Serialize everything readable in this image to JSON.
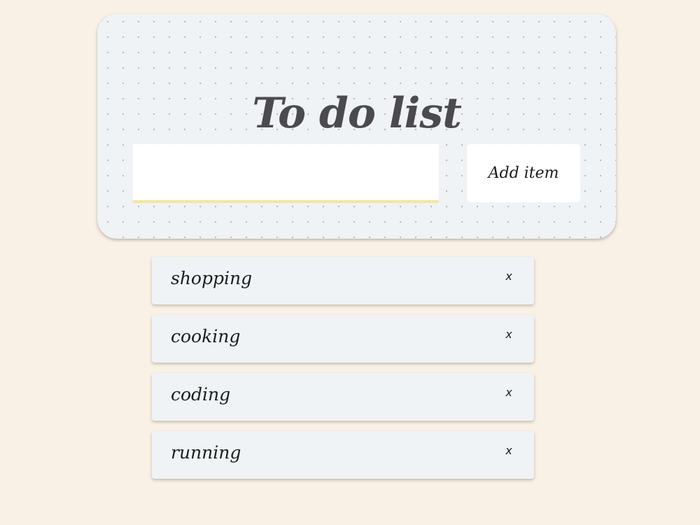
{
  "header": {
    "title": "To do list"
  },
  "form": {
    "input_value": "",
    "input_placeholder": "",
    "add_button_label": "Add item"
  },
  "todos": [
    {
      "text": "shopping",
      "delete_label": "x"
    },
    {
      "text": "cooking",
      "delete_label": "x"
    },
    {
      "text": "coding",
      "delete_label": "x"
    },
    {
      "text": "running",
      "delete_label": "x"
    }
  ],
  "colors": {
    "page_background": "#faf1e6",
    "card_background": "#eff3f6",
    "title_text": "#4b4b4f",
    "input_underline": "#f8e59c"
  }
}
